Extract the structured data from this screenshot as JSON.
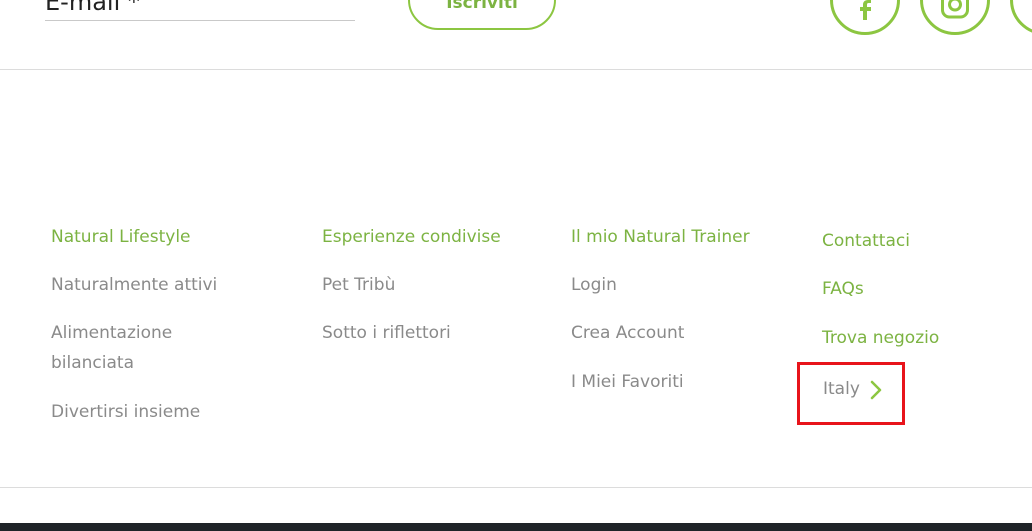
{
  "newsletter": {
    "email_label": "E-mail *",
    "subscribe_label": "Iscriviti"
  },
  "social": {
    "icons": [
      "facebook-icon",
      "instagram-icon"
    ]
  },
  "footer": {
    "columns": [
      {
        "heading": "Natural Lifestyle",
        "links": [
          "Naturalmente attivi",
          "Alimentazione bilanciata",
          "Divertirsi insieme"
        ]
      },
      {
        "heading": "Esperienze condivise",
        "links": [
          "Pet Tribù",
          "Sotto i riflettori"
        ]
      },
      {
        "heading": "Il mio Natural Trainer",
        "links": [
          "Login",
          "Crea Account",
          "I Miei Favoriti"
        ]
      },
      {
        "links": [
          "Contattaci",
          "FAQs",
          "Trova negozio"
        ]
      }
    ],
    "country": "Italy"
  },
  "colors": {
    "accent": "#7cb342",
    "link_gray": "#8a8a8a",
    "highlight": "#e8141b",
    "bottom_bar": "#1f2428"
  }
}
